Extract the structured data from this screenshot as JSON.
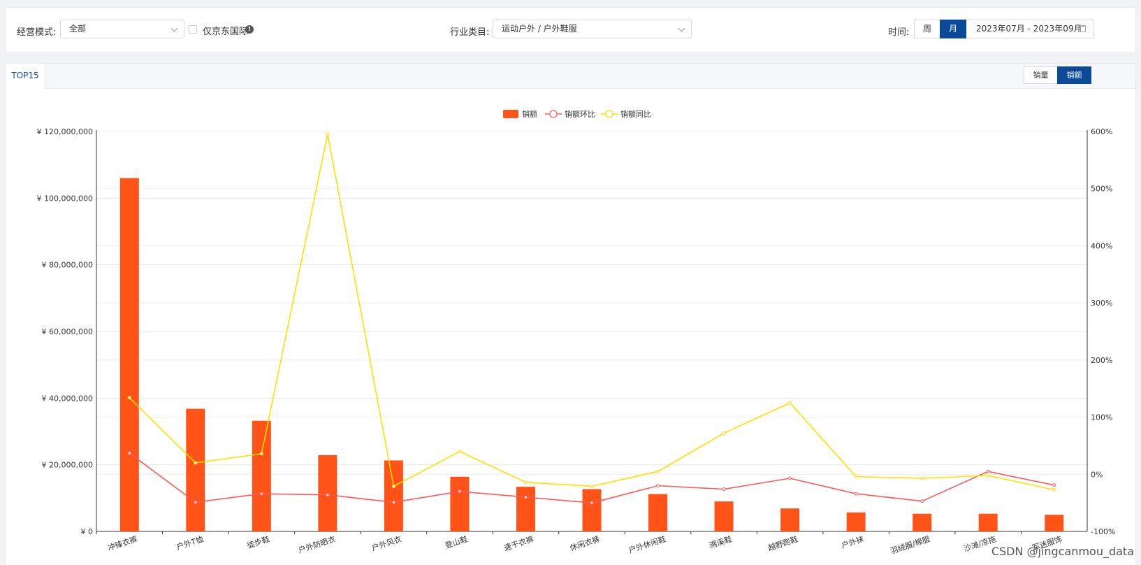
{
  "filters": {
    "mode_label": "经营模式:",
    "mode_value": "全部",
    "jd_intl_label": "仅京东国际",
    "info_icon": "!",
    "category_label": "行业类目:",
    "category_value": "运动户外 / 户外鞋服",
    "time_label": "时间:",
    "week_label": "周",
    "month_label": "月",
    "date_range": "2023年07月 - 2023年09月"
  },
  "panel": {
    "tab_label": "TOP15",
    "volume_label": "销量",
    "amount_label": "销额"
  },
  "colors": {
    "bar": "#ff5318",
    "mom_line": "#ff5a5a",
    "yoy_line": "#ffe000",
    "accent": "#0b4a9a"
  },
  "chart_data": {
    "type": "bar",
    "categories": [
      "冲锋衣裤",
      "户外T恤",
      "徒步鞋",
      "户外防晒衣",
      "户外风衣",
      "登山鞋",
      "速干衣裤",
      "休闲衣裤",
      "户外休闲鞋",
      "溯溪鞋",
      "越野跑鞋",
      "户外袜",
      "羽绒服/棉服",
      "沙滩/凉拖",
      "军迷服饰"
    ],
    "series": [
      {
        "name": "销额",
        "type": "bar",
        "axis": "left",
        "values": [
          106000000,
          36800000,
          33200000,
          22900000,
          21300000,
          16400000,
          13400000,
          12700000,
          11200000,
          9000000,
          6900000,
          5700000,
          5300000,
          5300000,
          5000000
        ]
      },
      {
        "name": "销额环比",
        "type": "line",
        "axis": "right",
        "values": [
          37,
          -49,
          -34,
          -36,
          -49,
          -30,
          -40,
          -50,
          -20,
          -26,
          -7,
          -34,
          -47,
          5,
          -19
        ]
      },
      {
        "name": "销额同比",
        "type": "line",
        "axis": "right",
        "values": [
          134,
          20,
          36,
          595,
          -21,
          40,
          -14,
          -21,
          5,
          72,
          125,
          -4,
          -7,
          -2,
          -27
        ]
      }
    ],
    "left_axis": {
      "min": 0,
      "max": 120000000,
      "ticks": [
        "¥ 0",
        "¥ 20,000,000",
        "¥ 40,000,000",
        "¥ 60,000,000",
        "¥ 80,000,000",
        "¥ 100,000,000",
        "¥ 120,000,000"
      ]
    },
    "right_axis": {
      "min": -100,
      "max": 600,
      "ticks": [
        "-100%",
        "0%",
        "100%",
        "200%",
        "300%",
        "400%",
        "500%",
        "600%"
      ]
    },
    "legend_position": "top-center",
    "grid": true
  },
  "watermark": "CSDN @jingcanmou_data"
}
